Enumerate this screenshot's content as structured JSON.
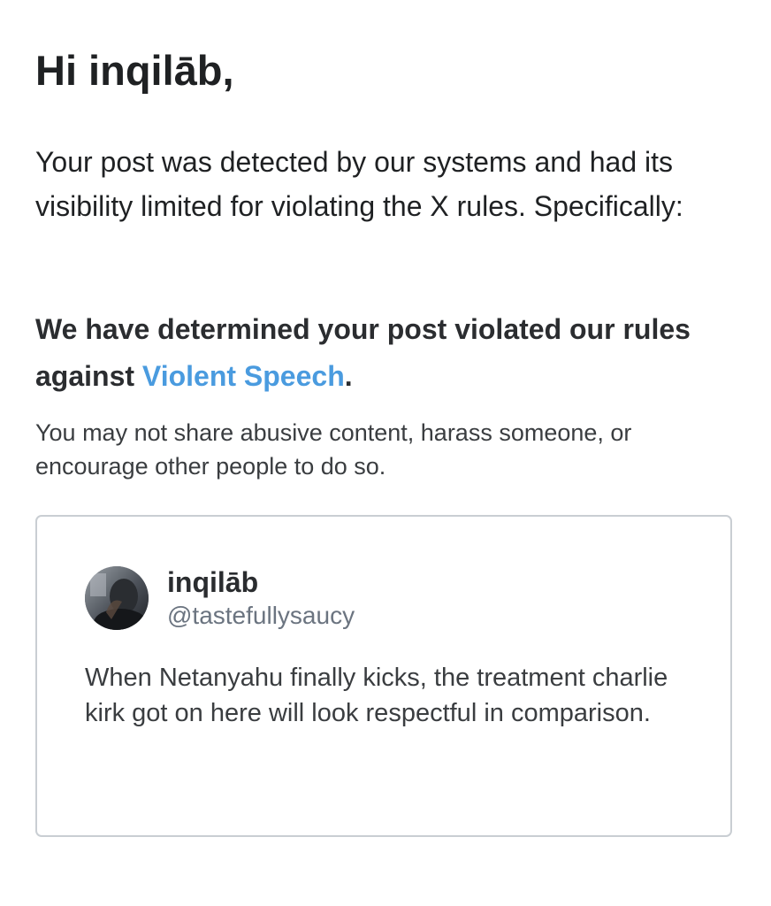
{
  "email": {
    "greeting": "Hi inqilāb,",
    "intro": "Your post was detected by our systems and had its visibility limited for violating the X rules. Specifically:",
    "verdict_prefix": "We have determined your post violated our rules against ",
    "rule_link": "Violent Speech",
    "verdict_suffix": ".",
    "explanation": "You may not share abusive content, harass someone, or encourage other people to do so."
  },
  "post": {
    "display_name": "inqilāb",
    "handle": "@tastefullysaucy",
    "text": "When Netanyahu finally kicks, the treatment charlie kirk got on here will look respectful in comparison.",
    "avatar_icon": "user-avatar"
  },
  "colors": {
    "link": "#4a9bdf",
    "card_border": "#c9ced3",
    "handle": "#6b7480"
  }
}
